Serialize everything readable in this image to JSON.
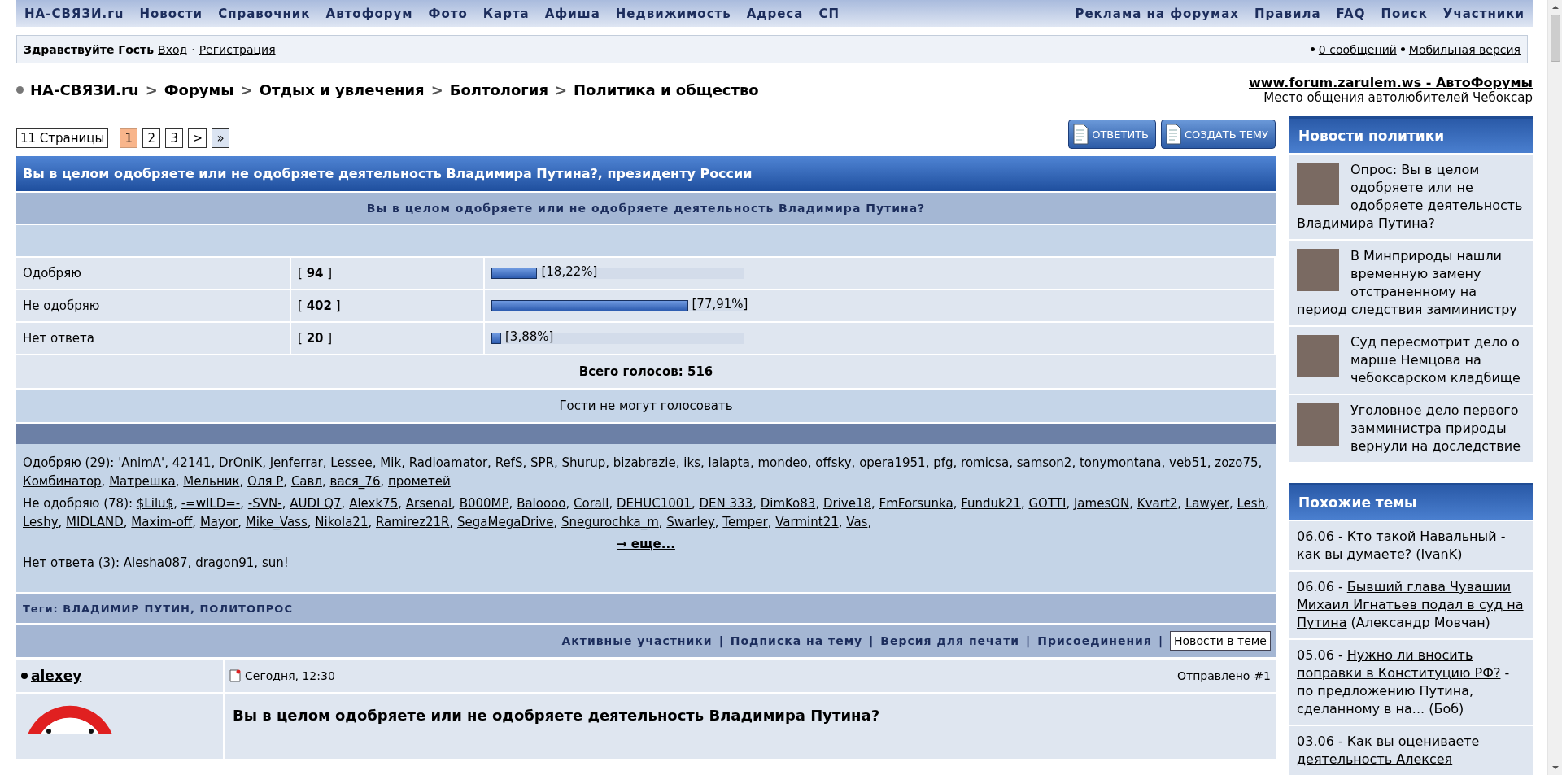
{
  "nav": {
    "left": [
      "НА-СВЯЗИ.ru",
      "Новости",
      "Справочник",
      "Автофорум",
      "Фото",
      "Карта",
      "Афиша",
      "Недвижимость",
      "Адреса",
      "СП"
    ],
    "right": [
      "Реклама на форумах",
      "Правила",
      "FAQ",
      "Поиск",
      "Участники"
    ]
  },
  "greeting": {
    "text": "Здравствуйте Гость",
    "login": "Вход",
    "separator": "·",
    "register": "Регистрация",
    "messages": "0 сообщений",
    "mobile": "Мобильная версия"
  },
  "breadcrumb": {
    "separator": ">",
    "items": [
      "НА-СВЯЗИ.ru",
      "Форумы",
      "Отдых и увлечения",
      "Болтология",
      "Политика и общество"
    ]
  },
  "promo": {
    "link": "www.forum.zarulem.ws - АвтоФорумы",
    "text": "Место общения автолюбителей Чебоксар"
  },
  "pages": {
    "label": "11 Страницы",
    "items": [
      {
        "label": "1",
        "kind": "page",
        "selected": true
      },
      {
        "label": "2",
        "kind": "page",
        "selected": false
      },
      {
        "label": "3",
        "kind": "page",
        "selected": false
      },
      {
        "label": ">",
        "kind": "next",
        "selected": false
      },
      {
        "label": "»",
        "kind": "last",
        "selected": false
      }
    ]
  },
  "actions": [
    "ОТВЕТИТЬ",
    "СОЗДАТЬ ТЕМУ"
  ],
  "poll": {
    "title": "Вы в целом одобряете или не одобряете деятельность Владимира Путина?, президенту России",
    "question": "Вы в целом одобряете или не одобряете деятельность Владимира Путина?",
    "options": [
      {
        "label": "Одобряю",
        "votes": "[ **94** ]",
        "level": 0.1822,
        "percent": "[18,22%]"
      },
      {
        "label": "Не одобряю",
        "votes": "[ **402** ]",
        "level": 0.7791,
        "percent": "[77,91%]"
      },
      {
        "label": "Нет ответа",
        "votes": "[ **20** ]",
        "level": 0.0388,
        "percent": "[3,88%]"
      }
    ],
    "total": "Всего голосов: 516",
    "guests": "Гости не могут голосовать"
  },
  "voters": {
    "separator": ",",
    "more": "→ еще...",
    "groups": [
      {
        "label": "Одобряю (29):",
        "trailing_separator": false,
        "names": [
          "'AnimA'",
          "42141",
          "DrOniK",
          "Jenferrar",
          "Lessee",
          "Mik",
          "Radioamator",
          "RefS",
          "SPR",
          "Shurup",
          "bizabrazie",
          "iks",
          "lalapta",
          "mondeo",
          "offsky",
          "opera1951",
          "pfg",
          "romicsa",
          "samson2",
          "tonymontana",
          "veb51",
          "zozo75",
          "Комбинатор",
          "Матрешка",
          "Мельник",
          "Оля Р",
          "Савл",
          "вася_76",
          "прометей"
        ]
      },
      {
        "label": "Не одобряю (78):",
        "trailing_separator": true,
        "names": [
          "$Lilu$",
          "-=wILD=-",
          "-SVN-",
          "AUDI Q7",
          "Alexk75",
          "Arsenal",
          "B000MP",
          "Baloooo",
          "Corall",
          "DEHUC1001",
          "DEN 333",
          "DimKo83",
          "Drive18",
          "FmForsunka",
          "Funduk21",
          "GOTTI",
          "JamesON",
          "Kvart2",
          "Lawyer",
          "Lesh",
          "Leshy",
          "MIDLAND",
          "Maxim-off",
          "Mayor",
          "Mike_Vass",
          "Nikola21",
          "Ramirez21R",
          "SegaMegaDrive",
          "Snegurochka_m",
          "Swarley",
          "Temper",
          "Varmint21",
          "Vas"
        ]
      },
      {
        "label": "Нет ответа (3):",
        "trailing_separator": false,
        "names": [
          "Alesha087",
          "dragon91",
          "sun!"
        ]
      }
    ]
  },
  "tags": "Теги: ВЛАДИМИР ПУТИН, ПОЛИТОПРОС",
  "topic_links": {
    "separator": "|",
    "items": [
      "Активные участники",
      "Подписка на тему",
      "Версия для печати",
      "Присоединения"
    ],
    "button": "Новости в теме"
  },
  "post": {
    "author": "alexey",
    "date": "Сегодня, 12:30",
    "sent": "Отправлено",
    "number": "#1",
    "title": "Вы в целом одобряете или не одобряете деятельность Владимира Путина?"
  },
  "news": {
    "title": "Новости политики",
    "items": [
      "Опрос: Вы в целом одобряете или не одобряете деятельность Владимира Путина?",
      "В Минприроды нашли временную замену отстраненному на период следствия замминистру",
      "Суд пересмотрит дело о марше Немцова на чебоксарском кладбище",
      "Уголовное дело первого замминистра природы вернули на доследствие"
    ]
  },
  "similar": {
    "title": "Похожие темы",
    "items": [
      {
        "date": "06.06 -",
        "link": "Кто такой Навальный",
        "rest": "- как вы думаете? (IvanK)"
      },
      {
        "date": "06.06 -",
        "link": "Бывший глава Чувашии Михаил Игнатьев подал в суд на Путина",
        "rest": "(Александр Мовчан)"
      },
      {
        "date": "05.06 -",
        "link": "Нужно ли вносить поправки в Конституцию РФ?",
        "rest": "- по предложению Путина, сделанному в на... (Боб)"
      },
      {
        "date": "03.06 -",
        "link": "Как вы оцениваете деятельность Алексея"
      }
    ]
  }
}
